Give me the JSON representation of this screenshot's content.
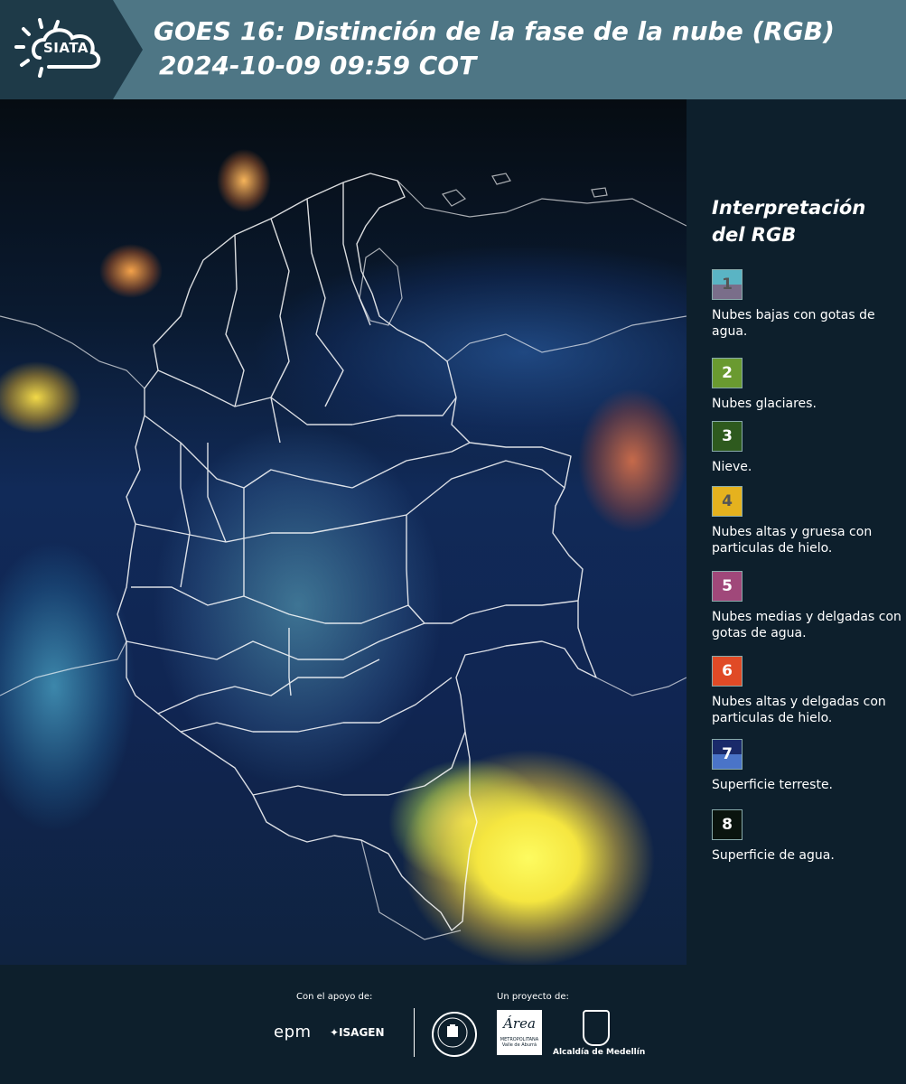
{
  "header": {
    "logo_text": "SIATA",
    "title_line1": "GOES 16: Distinción de la fase de la nube (RGB)",
    "title_line2": "2024-10-09 09:59 COT"
  },
  "legend": {
    "title_line1": "Interpretación",
    "title_line2": "del RGB",
    "items": [
      {
        "num": "1",
        "label": "Nubes bajas con gotas de agua.",
        "color_top": "#5ab4c4",
        "color_bottom": "#7a6e8a",
        "num_color": "#555555"
      },
      {
        "num": "2",
        "label": "Nubes glaciares.",
        "color_top": "#6a9a30",
        "color_bottom": "#6a9a30",
        "num_color": "#ffffff"
      },
      {
        "num": "3",
        "label": "Nieve.",
        "color_top": "#2e5a1e",
        "color_bottom": "#2e5a1e",
        "num_color": "#ffffff"
      },
      {
        "num": "4",
        "label": "Nubes altas y gruesa con particulas de hielo.",
        "color_top": "#e5b21e",
        "color_bottom": "#e5b21e",
        "num_color": "#555555"
      },
      {
        "num": "5",
        "label": "Nubes medias y delgadas con gotas de agua.",
        "color_top": "#a0487a",
        "color_bottom": "#a0487a",
        "num_color": "#ffffff"
      },
      {
        "num": "6",
        "label": "Nubes altas y delgadas con particulas de hielo.",
        "color_top": "#e04a26",
        "color_bottom": "#e04a26",
        "num_color": "#ffffff"
      },
      {
        "num": "7",
        "label": "Superficie terreste.",
        "color_top": "#1a2a6a",
        "color_bottom": "#4a74c8",
        "num_color": "#ffffff"
      },
      {
        "num": "8",
        "label": "Superficie de agua.",
        "color_top": "#0a140e",
        "color_bottom": "#0a140e",
        "num_color": "#ffffff"
      }
    ]
  },
  "footer": {
    "support_label": "Con el apoyo de:",
    "project_label": "Un proyecto de:",
    "sponsor1": "epm",
    "sponsor2": "ISAGEN",
    "partner_area_line1": "Área",
    "partner_area_line2": "METROPOLITANA",
    "partner_area_line3": "Valle de Aburrá",
    "partner_alcaldia": "Alcaldía de Medellín"
  },
  "colors": {
    "header_bg": "#4e7685",
    "logo_bg": "#1e3a48",
    "page_bg": "#0d1f2c"
  }
}
